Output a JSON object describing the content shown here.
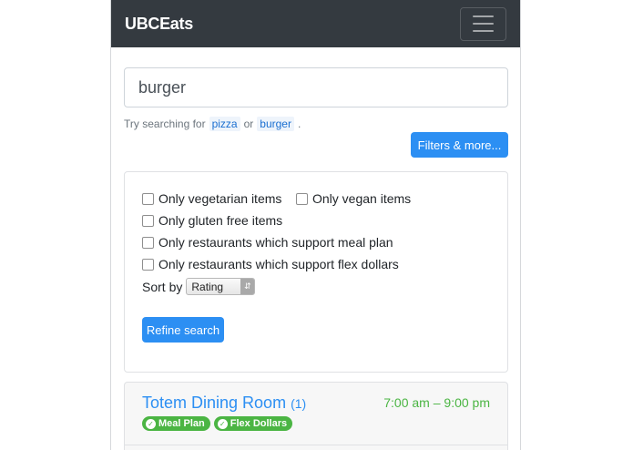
{
  "navbar": {
    "brand": "UBCEats",
    "menu_icon": "hamburger-menu-icon"
  },
  "search": {
    "value": "burger",
    "hint_prefix": "Try searching for",
    "hint_example_1": "pizza",
    "hint_or": "or",
    "hint_example_2": "burger",
    "hint_suffix": "."
  },
  "filters_button_label": "Filters & more...",
  "filters": {
    "options": [
      "Only vegetarian items",
      "Only vegan items",
      "Only gluten free items",
      "Only restaurants which support meal plan",
      "Only restaurants which support flex dollars"
    ],
    "sort_label": "Sort by",
    "sort_value": "Rating",
    "refine_label": "Refine search"
  },
  "result": {
    "name": "Totem Dining Room",
    "count": "(1)",
    "hours": "7:00 am – 9:00 pm",
    "badges": [
      "Meal Plan",
      "Flex Dollars"
    ],
    "badge_icon": "check-circle-icon"
  },
  "colors": {
    "navbar": "#343a40",
    "primary": "#2c8ff3",
    "success": "#4bb543"
  }
}
